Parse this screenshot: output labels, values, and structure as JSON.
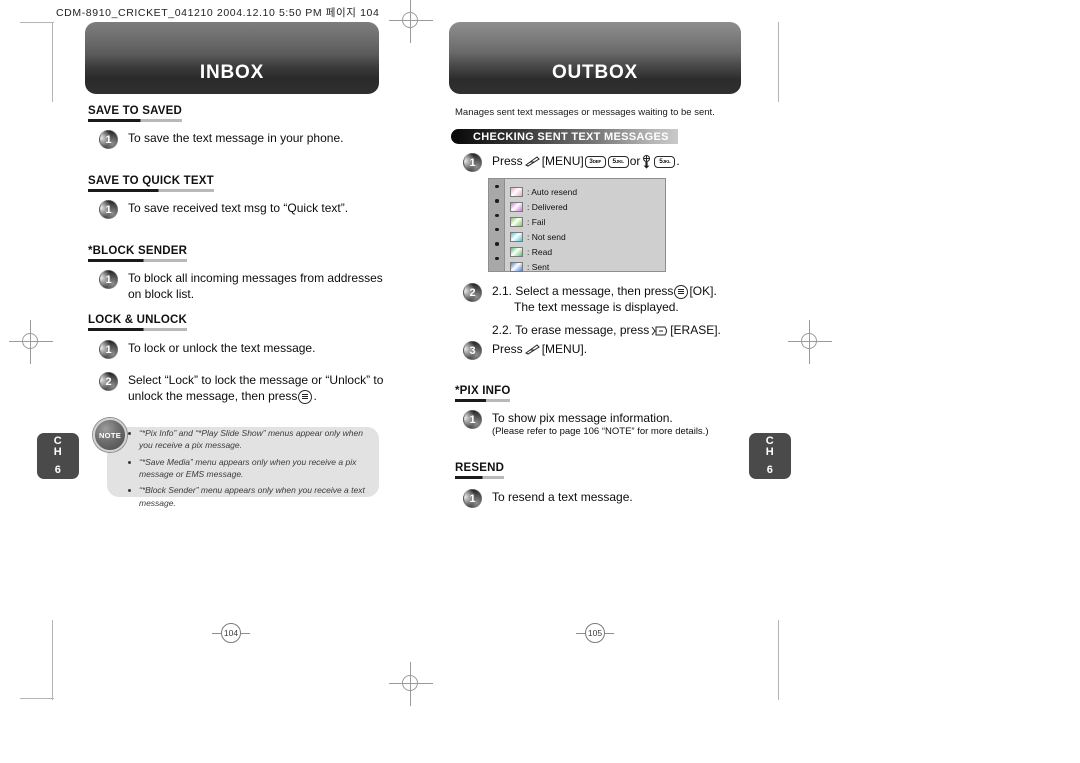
{
  "file_header": "CDM-8910_CRICKET_041210  2004.12.10 5:50 PM 페이지 104",
  "chapter_tab": {
    "line1": "C",
    "line2": "H",
    "number": "6"
  },
  "inbox": {
    "banner": "INBOX",
    "sections": [
      {
        "title": "SAVE TO SAVED",
        "steps": [
          {
            "num": "1",
            "text": "To save the text message in your phone."
          }
        ]
      },
      {
        "title": "SAVE TO QUICK TEXT",
        "steps": [
          {
            "num": "1",
            "text": "To save received text msg to “Quick text”."
          }
        ]
      },
      {
        "title": "*BLOCK SENDER",
        "steps": [
          {
            "num": "1",
            "text": "To block all incoming messages from addresses on block list."
          }
        ]
      },
      {
        "title": "LOCK & UNLOCK",
        "steps": [
          {
            "num": "1",
            "text": "To lock or unlock the text message."
          },
          {
            "num": "2",
            "text_before": "Select “Lock” to lock the message or “Unlock” to unlock the message, then press",
            "text_after": "."
          }
        ]
      }
    ],
    "note": {
      "badge": "NOTE",
      "items": [
        "“*Pix Info” and “*Play Slide Show” menus appear only when you receive a pix message.",
        "“*Save Media” menu appears only when you receive a pix message or EMS message.",
        "“*Block Sender” menu appears only when you receive a text message."
      ]
    },
    "page_number": "104"
  },
  "outbox": {
    "banner": "OUTBOX",
    "intro": "Manages sent text messages or messages waiting to be sent.",
    "bar_title": "CHECKING SENT TEXT MESSAGES",
    "step1": {
      "num": "1",
      "press_label": "Press",
      "menu_label": "[MENU]",
      "key3": "3",
      "key3_sup": "DEF",
      "key5a": "5",
      "key5a_sup": "JKL",
      "or_label": "or",
      "key5b": "5",
      "key5b_sup": "JKL",
      "period": "."
    },
    "status_box": {
      "rows": [
        {
          "label": ": Auto resend",
          "icon_color": "#e8a6c0"
        },
        {
          "label": ": Delivered",
          "icon_color": "#c878d8"
        },
        {
          "label": ": Fail",
          "icon_color": "#79c94a"
        },
        {
          "label": ": Not send",
          "icon_color": "#43c8d6"
        },
        {
          "label": ": Read",
          "icon_color": "#58c06a"
        },
        {
          "label": ": Sent",
          "icon_color": "#4d7fd6"
        }
      ]
    },
    "step2": {
      "num": "2",
      "line1_before": "2.1. Select a message, then press",
      "line1_after": "[OK].",
      "line2": "The text message is displayed.",
      "line3_before": "2.2. To erase message, press",
      "line3_after": "[ERASE]."
    },
    "step3": {
      "num": "3",
      "press_label": "Press",
      "menu_label": "[MENU]."
    },
    "sections": [
      {
        "title": "*PIX INFO",
        "steps": [
          {
            "num": "1",
            "text": "To show pix message information.",
            "sub": "(Please refer to page 106 “NOTE” for more details.)"
          }
        ]
      },
      {
        "title": "RESEND",
        "steps": [
          {
            "num": "1",
            "text": "To resend a text message."
          }
        ]
      }
    ],
    "page_number": "105"
  }
}
